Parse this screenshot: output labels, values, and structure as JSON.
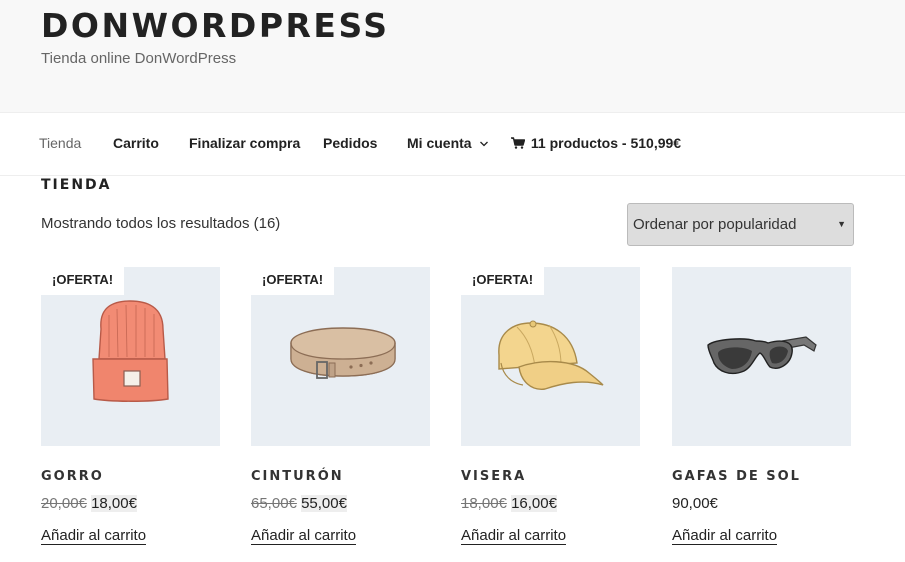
{
  "site": {
    "title": "DONWORDPRESS",
    "description": "Tienda online DonWordPress"
  },
  "nav": {
    "items": [
      "Tienda",
      "Carrito",
      "Finalizar compra",
      "Pedidos",
      "Mi cuenta"
    ],
    "cart_label": "11 productos - 510,99€"
  },
  "main": {
    "title": "TIENDA",
    "result_count": "Mostrando todos los resultados (16)",
    "ordering": "Ordenar por popularidad"
  },
  "products": [
    {
      "name": "GORRO",
      "old_price": "20,00€",
      "price": "18,00€",
      "badge": "¡OFERTA!",
      "button": "Añadir al carrito"
    },
    {
      "name": "CINTURÓN",
      "old_price": "65,00€",
      "price": "55,00€",
      "badge": "¡OFERTA!",
      "button": "Añadir al carrito"
    },
    {
      "name": "VISERA",
      "old_price": "18,00€",
      "price": "16,00€",
      "badge": "¡OFERTA!",
      "button": "Añadir al carrito"
    },
    {
      "name": "GAFAS DE SOL",
      "price": "90,00€",
      "button": "Añadir al carrito"
    }
  ],
  "colors": {
    "header_bg": "#f8f8f8",
    "thumb_bg": "#e9eef3",
    "beanie": "#f28b74",
    "belt": "#c9a98a",
    "cap": "#f3d58e",
    "sunglasses": "#555555"
  },
  "icons": [
    "chevron-down-icon",
    "cart-icon",
    "select-arrow-icon"
  ]
}
